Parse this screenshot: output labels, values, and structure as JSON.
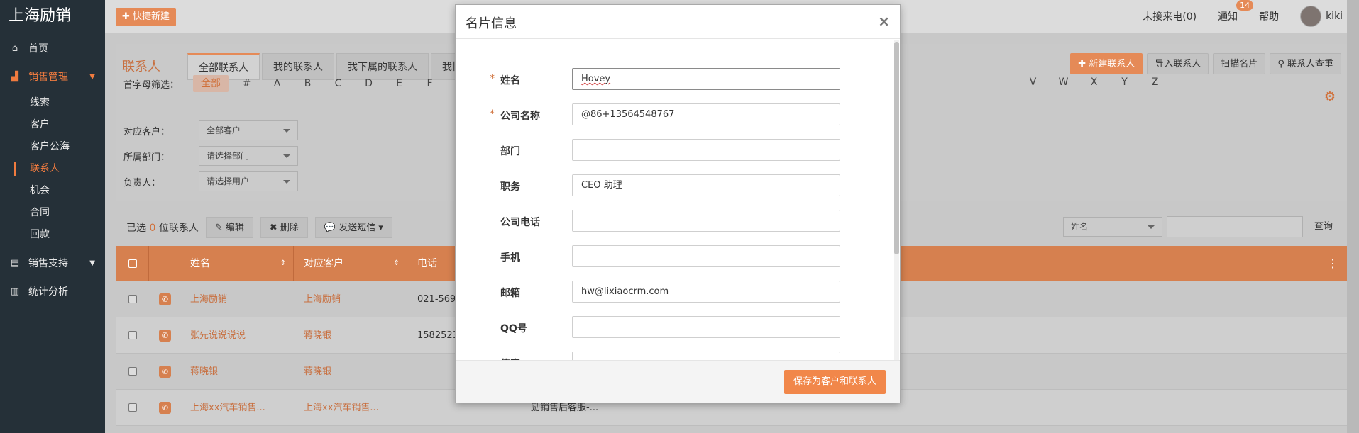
{
  "sidebar": {
    "brand": "上海励销",
    "items": [
      {
        "label": "首页",
        "icon": "home-icon"
      },
      {
        "label": "销售管理",
        "icon": "chart-area-icon",
        "active": true
      },
      {
        "label": "销售支持",
        "icon": "file-icon"
      },
      {
        "label": "统计分析",
        "icon": "bar-chart-icon"
      }
    ],
    "sub_items": [
      "线索",
      "客户",
      "客户公海",
      "联系人",
      "机会",
      "合同",
      "回款"
    ]
  },
  "topbar": {
    "quick_new": "快捷新建",
    "missed_calls": "未接来电(0)",
    "notify": "通知",
    "notify_count": "14",
    "help": "帮助",
    "user": "kiki"
  },
  "page": {
    "title": "联系人",
    "tabs": [
      "全部联系人",
      "我的联系人",
      "我下属的联系人",
      "我协"
    ],
    "actions": {
      "new_contact": "新建联系人",
      "import": "导入联系人",
      "scan_card": "扫描名片",
      "dedupe": "联系人查重"
    },
    "filters": {
      "letter_label": "首字母筛选：",
      "letters_left": [
        "全部",
        "#",
        "A",
        "B",
        "C",
        "D",
        "E",
        "F"
      ],
      "letters_right": [
        "V",
        "W",
        "X",
        "Y",
        "Z"
      ],
      "customer_label": "对应客户：",
      "customer_value": "全部客户",
      "dept_label": "所属部门：",
      "dept_value": "请选择部门",
      "owner_label": "负责人：",
      "owner_value": "请选择用户"
    }
  },
  "list": {
    "selected_prefix": "已选",
    "selected_count": "0",
    "selected_suffix": "位联系人",
    "edit": "编辑",
    "delete": "删除",
    "sms": "发送短信",
    "search_field": "姓名",
    "search_btn": "查询",
    "columns": [
      "姓名",
      "对应客户",
      "电话"
    ],
    "rows": [
      {
        "name": "上海励销",
        "customer": "上海励销",
        "phone": "021-569",
        "extra": ""
      },
      {
        "name": "张先说说说说",
        "customer": "蒋晓银",
        "phone": "1582523",
        "extra": ""
      },
      {
        "name": "蒋晓银",
        "customer": "蒋晓银",
        "phone": "",
        "extra": ""
      },
      {
        "name": "上海xx汽车销售...",
        "customer": "上海xx汽车销售...",
        "phone": "",
        "extra": "励销售后客服-..."
      }
    ]
  },
  "modal": {
    "title": "名片信息",
    "close": "×",
    "fields": [
      {
        "label": "姓名",
        "value": "Hovey",
        "required": true
      },
      {
        "label": "公司名称",
        "value": "@86+13564548767",
        "required": true
      },
      {
        "label": "部门",
        "value": "",
        "required": false
      },
      {
        "label": "职务",
        "value": "CEO 助理",
        "required": false
      },
      {
        "label": "公司电话",
        "value": "",
        "required": false
      },
      {
        "label": "手机",
        "value": "",
        "required": false
      },
      {
        "label": "邮箱",
        "value": "hw@lixiaocrm.com",
        "required": false
      },
      {
        "label": "QQ号",
        "value": "",
        "required": false
      },
      {
        "label": "传真",
        "value": "",
        "required": false
      }
    ],
    "save": "保存为客户和联系人"
  },
  "colors": {
    "accent": "#f1874a",
    "sidebar_bg": "#253038",
    "table_head": "#d6804f"
  }
}
